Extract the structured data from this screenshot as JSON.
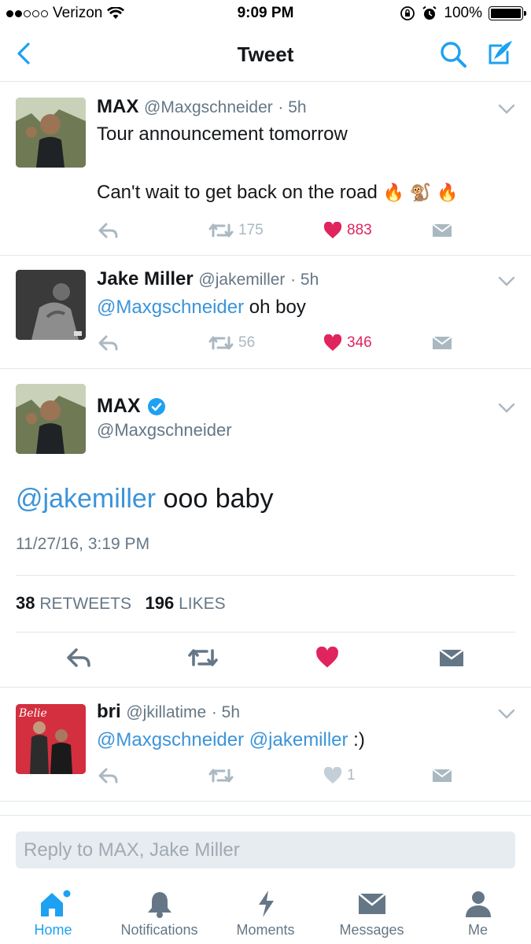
{
  "status_bar": {
    "carrier": "Verizon",
    "time": "9:09 PM",
    "battery": "100%"
  },
  "nav": {
    "title": "Tweet"
  },
  "tweets": [
    {
      "name": "MAX",
      "handle": "@Maxgschneider",
      "time": "· 5h",
      "line1": "Tour announcement tomorrow",
      "line2": "Can't wait to get back on the road",
      "emoji": "🔥 🐒 🔥",
      "retweets": "175",
      "likes": "883"
    },
    {
      "name": "Jake Miller",
      "handle": "@jakemiller",
      "time": "· 5h",
      "mention": "@Maxgschneider",
      "text": " oh boy",
      "retweets": "56",
      "likes": "346"
    }
  ],
  "main_tweet": {
    "name": "MAX",
    "handle": "@Maxgschneider",
    "mention": "@jakemiller",
    "text": " ooo baby",
    "date": "11/27/16, 3:19 PM",
    "retweet_count": "38",
    "retweet_label": "RETWEETS",
    "like_count": "196",
    "like_label": "LIKES"
  },
  "reply_tweet": {
    "name": "bri",
    "handle": "@jkillatime",
    "time": "· 5h",
    "mention1": "@Maxgschneider",
    "mention2": "@jakemiller",
    "text": " :)",
    "likes": "1"
  },
  "reply_box": {
    "placeholder": "Reply to MAX, Jake Miller"
  },
  "tabs": [
    {
      "label": "Home"
    },
    {
      "label": "Notifications"
    },
    {
      "label": "Moments"
    },
    {
      "label": "Messages"
    },
    {
      "label": "Me"
    }
  ],
  "colors": {
    "accent": "#1da1f2",
    "mention": "#3b94d9",
    "like": "#e0245e",
    "muted": "#657786"
  }
}
